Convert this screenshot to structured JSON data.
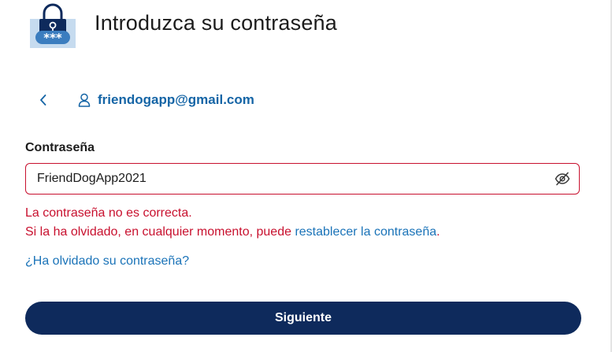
{
  "header": {
    "title": "Introduzca su contraseña",
    "logo_icon": "padlock-password-icon",
    "logo_text": "***"
  },
  "account": {
    "back_icon": "chevron-left-icon",
    "user_icon": "user-outline-icon",
    "email": "friendogapp@gmail.com"
  },
  "password_field": {
    "label": "Contraseña",
    "value": "FriendDogApp2021",
    "toggle_icon": "eye-slash-icon"
  },
  "error": {
    "line1": "La contraseña no es correcta.",
    "line2_prefix": "Si la ha olvidado, en cualquier momento, puede ",
    "reset_link": "restablecer la contraseña",
    "line2_suffix": "."
  },
  "forgot_link": "¿Ha olvidado su contraseña?",
  "next_button": "Siguiente",
  "colors": {
    "brand_navy": "#0e2a5c",
    "link_blue": "#1a73b8",
    "email_blue": "#1565a6",
    "error_red": "#c8102e",
    "logo_blue": "#3b7dbf"
  }
}
